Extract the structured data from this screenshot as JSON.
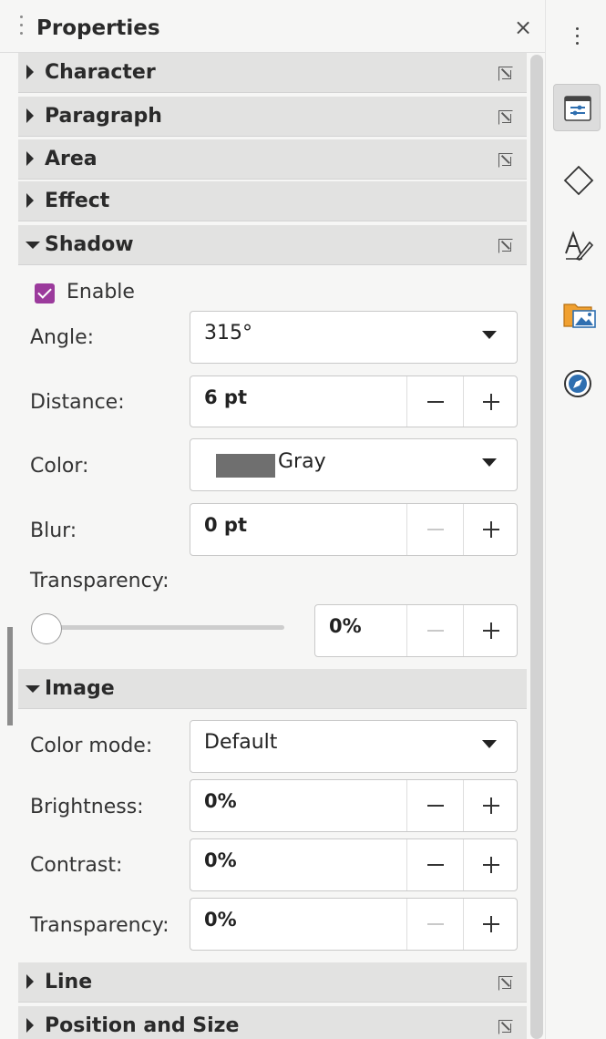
{
  "title": "Properties",
  "close_glyph": "×",
  "sections": {
    "character": "Character",
    "paragraph": "Paragraph",
    "area": "Area",
    "effect": "Effect",
    "shadow": "Shadow",
    "image": "Image",
    "line": "Line",
    "position_size": "Position and Size"
  },
  "shadow": {
    "enable_label": "Enable",
    "enable_checked": true,
    "angle_label": "Angle:",
    "angle_value": "315°",
    "distance_label": "Distance:",
    "distance_value": "6 pt",
    "color_label": "Color:",
    "color_value": "Gray",
    "color_swatch": "#6f6f6f",
    "blur_label": "Blur:",
    "blur_value": "0 pt",
    "transparency_label": "Transparency:",
    "transparency_value": "0%",
    "transparency_level": 0
  },
  "image": {
    "color_mode_label": "Color mode:",
    "color_mode_value": "Default",
    "brightness_label": "Brightness:",
    "brightness_value": "0%",
    "contrast_label": "Contrast:",
    "contrast_value": "0%",
    "transparency_label": "Transparency:",
    "transparency_value": "0%"
  },
  "colors": {
    "accent_checkbox": "#9b3a9c",
    "gallery_icon": "#f0a030",
    "navigator_icon": "#2f6fb0",
    "properties_icon": "#2f6fb0"
  },
  "tabs": [
    "properties-icon",
    "shapes-icon",
    "styles-icon",
    "gallery-icon",
    "navigator-icon"
  ]
}
